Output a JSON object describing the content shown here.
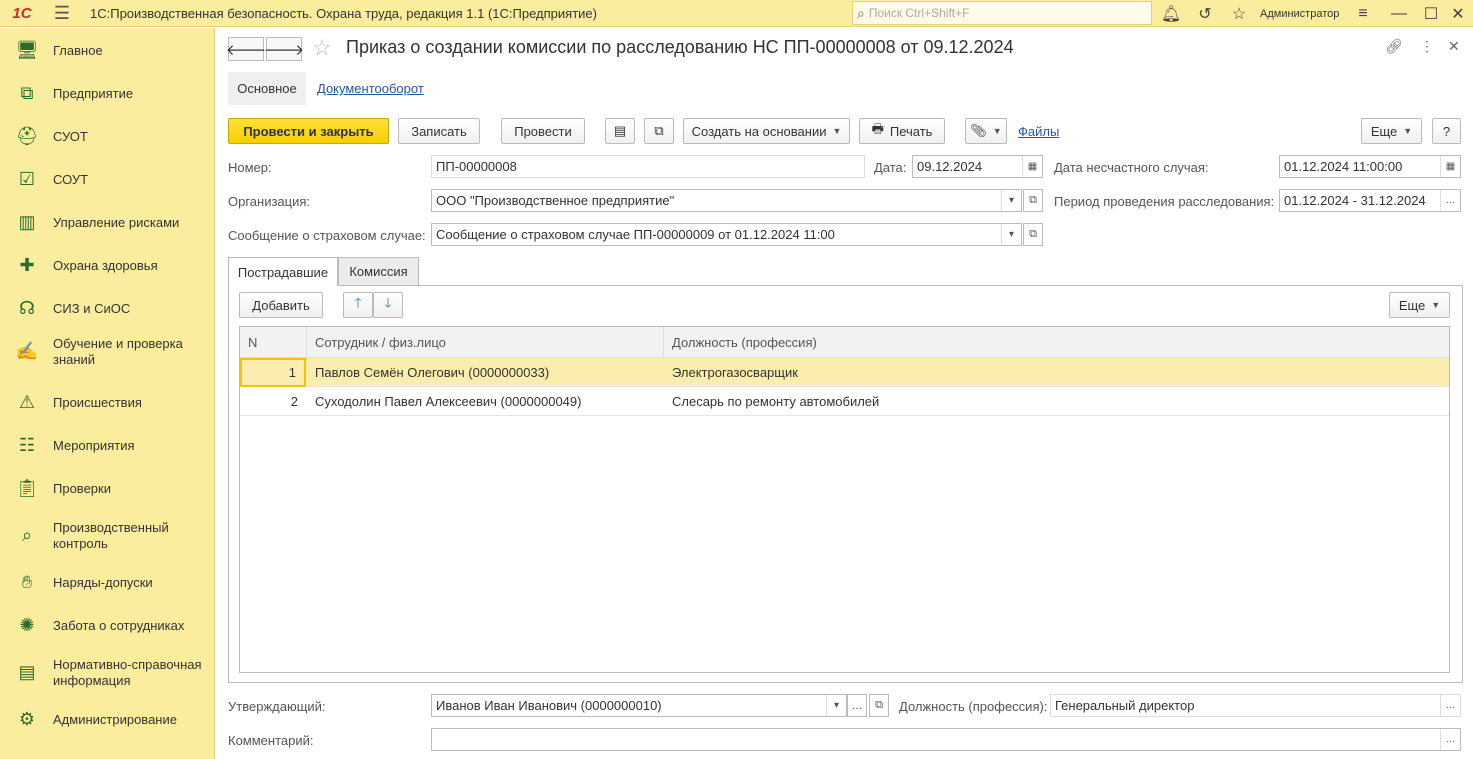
{
  "app": {
    "logo": "1С",
    "title": "1С:Производственная безопасность. Охрана труда, редакция 1.1  (1С:Предприятие)",
    "search_placeholder": "Поиск Ctrl+Shift+F",
    "user": "Администратор"
  },
  "sidebar": {
    "items": [
      {
        "label": "Главное",
        "icon": "desktop-icon"
      },
      {
        "label": "Предприятие",
        "icon": "org-structure-icon"
      },
      {
        "label": "СУОТ",
        "icon": "worker-helmet-icon"
      },
      {
        "label": "СОУТ",
        "icon": "checklist-icon"
      },
      {
        "label": "Управление рисками",
        "icon": "risk-chart-icon"
      },
      {
        "label": "Охрана здоровья",
        "icon": "medical-cross-icon"
      },
      {
        "label": "СИЗ и СиОС",
        "icon": "ppe-icon"
      },
      {
        "label": "Обучение и проверка знаний",
        "icon": "training-icon"
      },
      {
        "label": "Происшествия",
        "icon": "warning-triangle-icon"
      },
      {
        "label": "Мероприятия",
        "icon": "tasks-icon"
      },
      {
        "label": "Проверки",
        "icon": "clipboard-icon"
      },
      {
        "label": "Производственный контроль",
        "icon": "magnifier-chart-icon"
      },
      {
        "label": "Наряды-допуски",
        "icon": "permit-icon"
      },
      {
        "label": "Забота о сотрудниках",
        "icon": "care-icon"
      },
      {
        "label": "Нормативно-справочная информация",
        "icon": "books-icon"
      },
      {
        "label": "Администрирование",
        "icon": "admin-gear-icon"
      }
    ]
  },
  "document": {
    "title": "Приказ о создании комиссии по расследованию НС ПП-00000008 от 09.12.2024",
    "tabs": {
      "main": "Основное",
      "docflow": "Документооборот"
    }
  },
  "toolbar": {
    "post_close": "Провести и закрыть",
    "save": "Записать",
    "post": "Провести",
    "create_based": "Создать на основании",
    "print": "Печать",
    "files": "Файлы",
    "more": "Еще",
    "help": "?"
  },
  "form": {
    "number_label": "Номер:",
    "number_value": "ПП-00000008",
    "date_label": "Дата:",
    "date_value": "09.12.2024",
    "accident_date_label": "Дата несчастного случая:",
    "accident_date_value": "01.12.2024 11:00:00",
    "org_label": "Организация:",
    "org_value": "ООО \"Производственное предприятие\"",
    "period_label": "Период проведения расследования:",
    "period_value": "01.12.2024 - 31.12.2024",
    "report_label": "Сообщение о страховом случае:",
    "report_value": "Сообщение о страховом случае ПП-00000009 от 01.12.2024 11:00",
    "approver_label": "Утверждающий:",
    "approver_value": "Иванов Иван Иванович (0000000010)",
    "position_label": "Должность (профессия):",
    "position_value": "Генеральный директор",
    "comment_label": "Комментарий:",
    "comment_value": ""
  },
  "victims_tabs": {
    "victims": "Пострадавшие",
    "commission": "Комиссия"
  },
  "table_toolbar": {
    "add": "Добавить",
    "more": "Еще"
  },
  "table": {
    "columns": [
      "N",
      "Сотрудник / физ.лицо",
      "Должность (профессия)"
    ],
    "rows": [
      {
        "n": "1",
        "employee": "Павлов Семён Олегович (0000000033)",
        "position": "Электрогазосварщик"
      },
      {
        "n": "2",
        "employee": "Суходолин Павел Алексеевич (0000000049)",
        "position": "Слесарь по ремонту автомобилей"
      }
    ]
  }
}
